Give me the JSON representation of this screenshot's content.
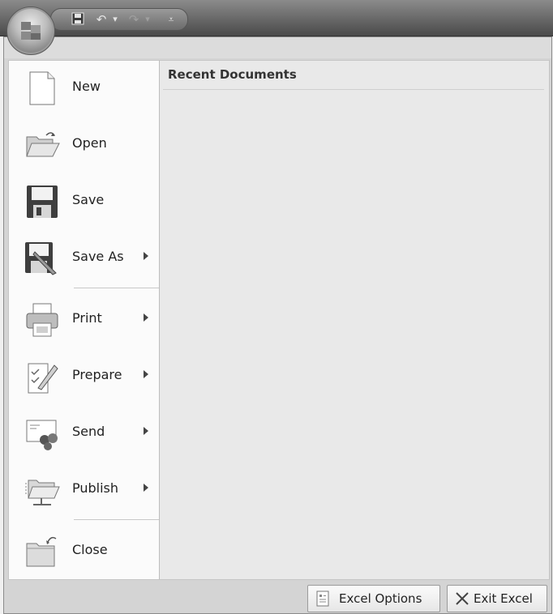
{
  "qat": {
    "undo_icon": "↶",
    "redo_icon": "↷",
    "dropdown_icon": "▾",
    "customize_icon": "⩡"
  },
  "menu": {
    "items": [
      {
        "label": "New",
        "has_submenu": false
      },
      {
        "label": "Open",
        "has_submenu": false
      },
      {
        "label": "Save",
        "has_submenu": false
      },
      {
        "label": "Save As",
        "has_submenu": true
      },
      {
        "label": "Print",
        "has_submenu": true
      },
      {
        "label": "Prepare",
        "has_submenu": true
      },
      {
        "label": "Send",
        "has_submenu": true
      },
      {
        "label": "Publish",
        "has_submenu": true
      },
      {
        "label": "Close",
        "has_submenu": false
      }
    ]
  },
  "recent": {
    "header": "Recent Documents"
  },
  "footer": {
    "options_label": "Excel Options",
    "exit_label": "Exit Excel"
  }
}
